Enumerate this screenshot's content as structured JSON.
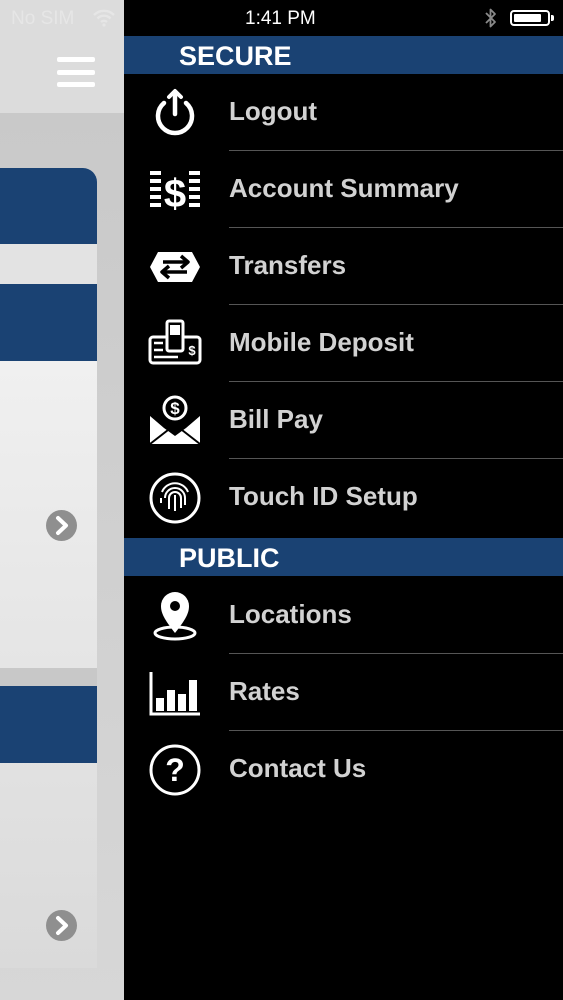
{
  "status_bar": {
    "carrier": "No SIM",
    "time": "1:41 PM"
  },
  "drawer": {
    "sections": [
      {
        "title": "SECURE",
        "items": [
          {
            "label": "Logout",
            "icon": "power-icon"
          },
          {
            "label": "Account Summary",
            "icon": "dollar-list-icon"
          },
          {
            "label": "Transfers",
            "icon": "transfer-arrows-icon"
          },
          {
            "label": "Mobile Deposit",
            "icon": "check-deposit-icon"
          },
          {
            "label": "Bill Pay",
            "icon": "envelope-dollar-icon"
          },
          {
            "label": "Touch ID Setup",
            "icon": "fingerprint-icon"
          }
        ]
      },
      {
        "title": "PUBLIC",
        "items": [
          {
            "label": "Locations",
            "icon": "location-pin-icon"
          },
          {
            "label": "Rates",
            "icon": "bar-chart-icon"
          },
          {
            "label": "Contact Us",
            "icon": "question-mark-icon"
          }
        ]
      }
    ]
  },
  "colors": {
    "header_blue": "#1a4273",
    "drawer_bg": "#000000",
    "item_text": "#d2d2d2"
  }
}
